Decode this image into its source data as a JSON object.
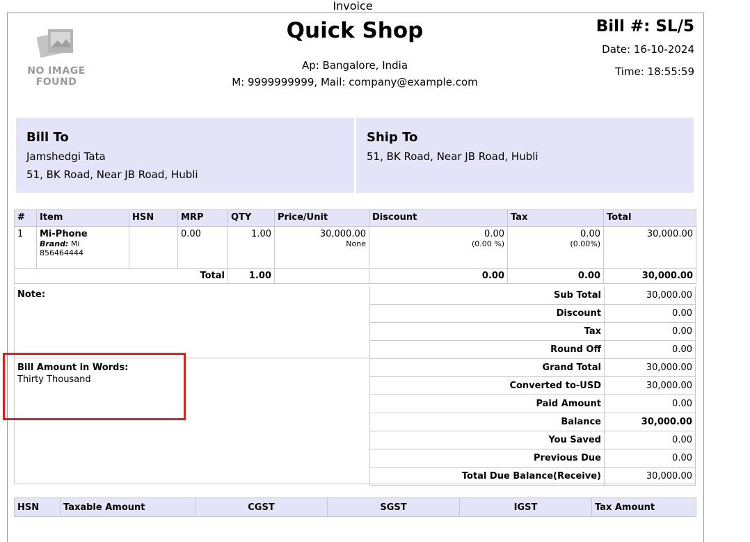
{
  "window": {
    "title": "Invoice"
  },
  "logo": {
    "line1": "NO IMAGE",
    "line2": "FOUND"
  },
  "shop": {
    "name": "Quick Shop",
    "address": "Ap: Bangalore, India",
    "contact": "M: 9999999999, Mail: company@example.com"
  },
  "bill": {
    "number": "Bill #: SL/5",
    "date": "Date: 16-10-2024",
    "time": "Time: 18:55:59"
  },
  "bill_to": {
    "heading": "Bill To",
    "name": "Jamshedgi Tata",
    "address": "51, BK Road, Near JB Road, Hubli"
  },
  "ship_to": {
    "heading": "Ship To",
    "address": "51, BK Road, Near JB Road, Hubli"
  },
  "items": {
    "headers": [
      "#",
      "Item",
      "HSN",
      "MRP",
      "QTY",
      "Price/Unit",
      "Discount",
      "Tax",
      "Total"
    ],
    "rows": [
      {
        "no": "1",
        "name": "Mi-Phone",
        "brand_label": "Brand:",
        "brand": " Mi",
        "code": "856464444",
        "hsn": "",
        "mrp": "0.00",
        "qty": "1.00",
        "price": "30,000.00",
        "price_note": "None",
        "discount": "0.00",
        "discount_pct": "(0.00 %)",
        "tax": "0.00",
        "tax_pct": "(0.00%)",
        "total": "30,000.00"
      }
    ],
    "total_row": {
      "label": "Total",
      "qty": "1.00",
      "discount": "0.00",
      "tax": "0.00",
      "total": "30,000.00"
    }
  },
  "note_label": "Note:",
  "amount_words": {
    "label": "Bill Amount in Words:",
    "value": "Thirty Thousand"
  },
  "summary": [
    {
      "label": "Sub Total",
      "value": "30,000.00"
    },
    {
      "label": "Discount",
      "value": "0.00"
    },
    {
      "label": "Tax",
      "value": "0.00"
    },
    {
      "label": "Round Off",
      "value": "0.00"
    },
    {
      "label": "Grand Total",
      "value": "30,000.00"
    },
    {
      "label": "Converted to-USD",
      "value": "30,000.00"
    },
    {
      "label": "Paid Amount",
      "value": "0.00"
    },
    {
      "label": "Balance",
      "value": "30,000.00",
      "bold": true
    },
    {
      "label": "You Saved",
      "value": "0.00"
    },
    {
      "label": "Previous Due",
      "value": "0.00"
    },
    {
      "label": "Total Due Balance(Receive)",
      "value": "30,000.00"
    }
  ],
  "tax_table": {
    "headers": [
      "HSN",
      "Taxable Amount",
      "CGST",
      "SGST",
      "IGST",
      "Tax Amount"
    ]
  },
  "colors": {
    "panel_bg": "#e3e4f7",
    "highlight": "#e02020",
    "border": "#c8c8c8"
  }
}
